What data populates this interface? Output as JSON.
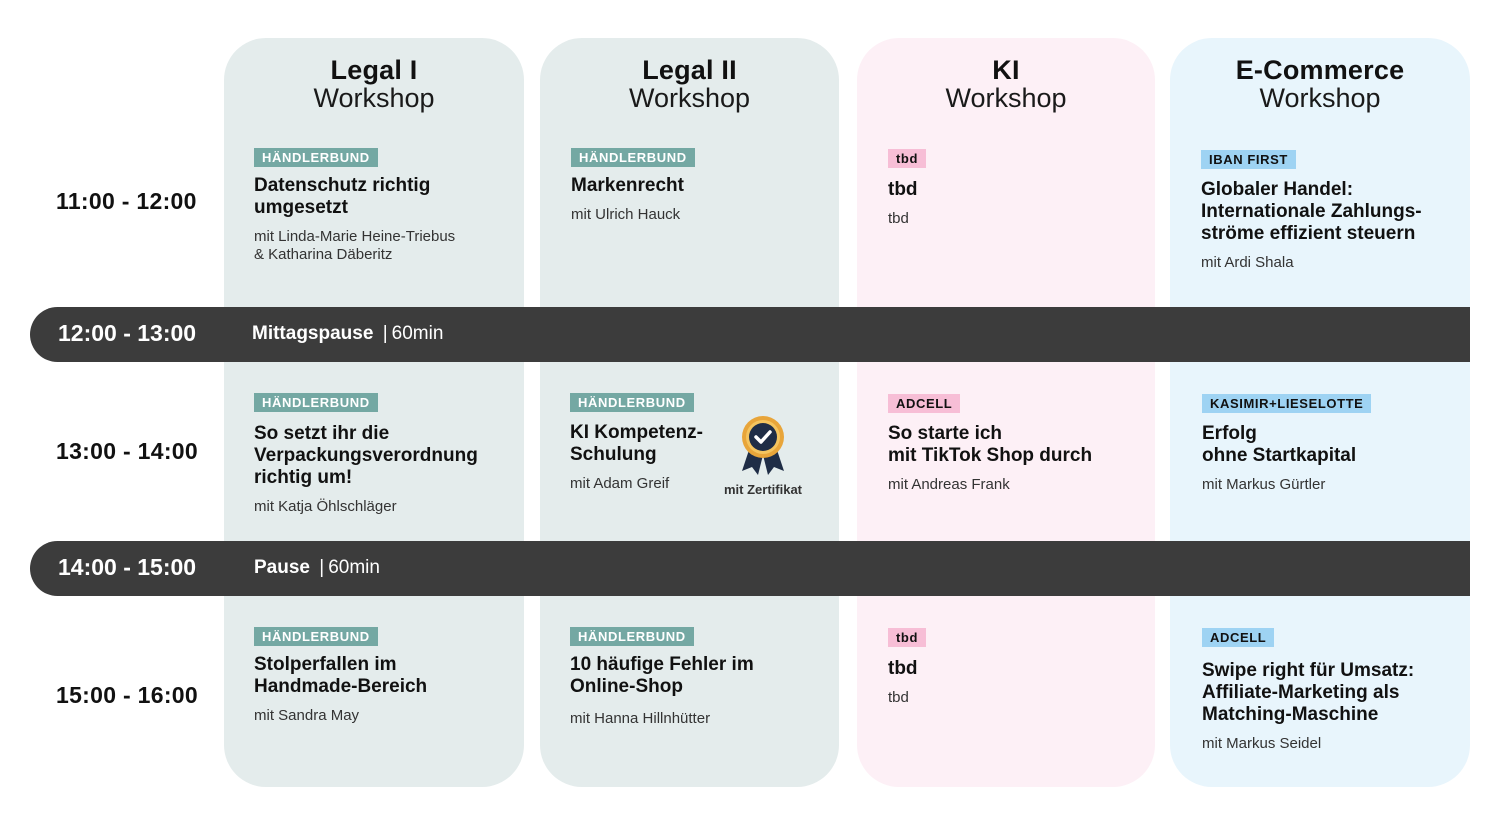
{
  "columns": [
    {
      "title": "Legal I",
      "subtitle": "Workshop",
      "bg": "#e4ecec"
    },
    {
      "title": "Legal II",
      "subtitle": "Workshop",
      "bg": "#e4ecec"
    },
    {
      "title": "KI",
      "subtitle": "Workshop",
      "bg": "#fdf0f6"
    },
    {
      "title": "E-Commerce",
      "subtitle": "Workshop",
      "bg": "#e8f5fc"
    }
  ],
  "times": {
    "slot1": "11:00 - 12:00",
    "slot2": "13:00 - 14:00",
    "slot3": "15:00 - 16:00"
  },
  "breaks": {
    "lunch": {
      "time": "12:00 - 13:00",
      "label": "Mittagspause",
      "sep": "|",
      "duration": "60min"
    },
    "pause": {
      "time": "14:00 - 15:00",
      "label": "Pause",
      "sep": "|",
      "duration": "60min"
    }
  },
  "sessions": {
    "r1c1": {
      "tag": "HÄNDLERBUND",
      "title": "Datenschutz richtig\numgesetzt",
      "speaker": "mit Linda-Marie Heine-Triebus\n& Katharina Däberitz"
    },
    "r1c2": {
      "tag": "HÄNDLERBUND",
      "title": "Markenrecht",
      "speaker": "mit Ulrich Hauck"
    },
    "r1c3": {
      "tag": "tbd",
      "title": "tbd",
      "speaker": "tbd"
    },
    "r1c4": {
      "tag": "IBAN FIRST",
      "title": "Globaler Handel:\nInternationale Zahlungs-\nströme effizient steuern",
      "speaker": "mit Ardi Shala"
    },
    "r2c1": {
      "tag": "HÄNDLERBUND",
      "title": "So setzt ihr die\nVerpackungsverordnung\nrichtig um!",
      "speaker": "mit Katja Öhlschläger"
    },
    "r2c2": {
      "tag": "HÄNDLERBUND",
      "title": "KI Kompetenz-\nSchulung",
      "speaker": "mit Adam Greif",
      "badge": "mit Zertifikat"
    },
    "r2c3": {
      "tag": "ADCELL",
      "title": "So starte ich\nmit TikTok Shop durch",
      "speaker": "mit Andreas Frank"
    },
    "r2c4": {
      "tag": "KASIMIR+LIESELOTTE",
      "title": "Erfolg\nohne Startkapital",
      "speaker": "mit Markus Gürtler"
    },
    "r3c1": {
      "tag": "HÄNDLERBUND",
      "title": "Stolperfallen im\nHandmade-Bereich",
      "speaker": "mit Sandra May"
    },
    "r3c2": {
      "tag": "HÄNDLERBUND",
      "title": "10 häufige Fehler im\nOnline-Shop",
      "speaker": "mit Hanna Hillnhütter"
    },
    "r3c3": {
      "tag": "tbd",
      "title": "tbd",
      "speaker": "tbd"
    },
    "r3c4": {
      "tag": "ADCELL",
      "title": "Swipe right für Umsatz:\nAffiliate-Marketing als\nMatching-Maschine",
      "speaker": "mit Markus Seidel"
    }
  },
  "colors": {
    "band": "#3c3c3c",
    "tag_haendlerbund": "#74a8a3",
    "tag_pink": "#f7bed6",
    "tag_blue": "#9ed3f3",
    "badge_gold": "#e8a53a",
    "badge_navy": "#1f2d46"
  }
}
